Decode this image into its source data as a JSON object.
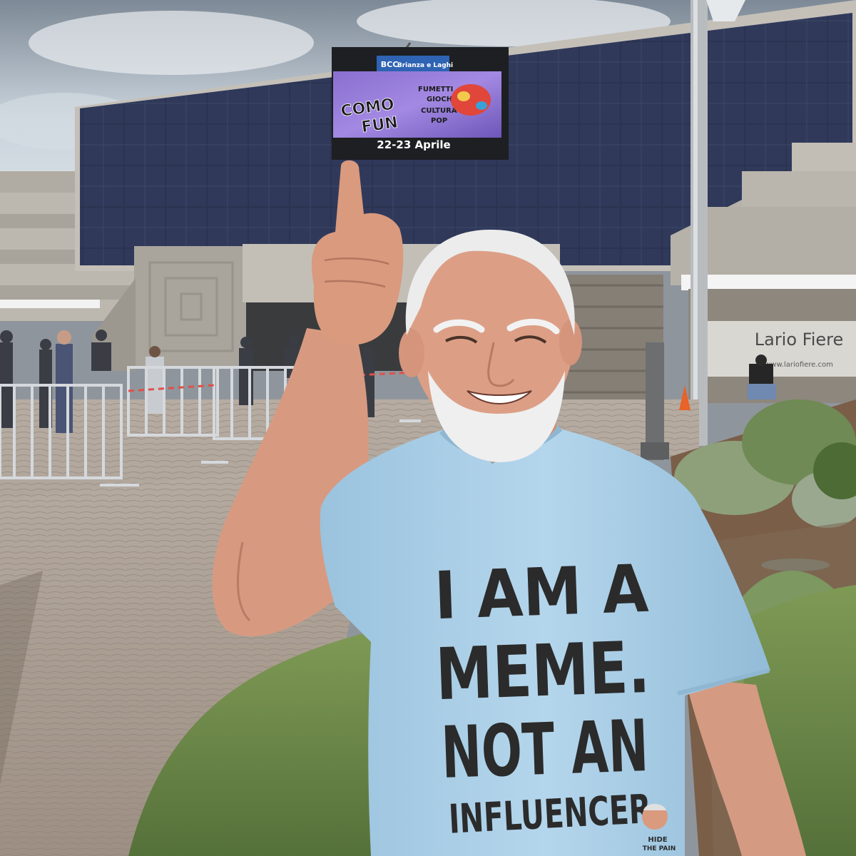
{
  "scene": {
    "billboard": {
      "sponsor_badge": "BCC",
      "sponsor_text": "Brianza e Laghi",
      "line1": "COMO",
      "line2": "FUN",
      "sub1": "FUMETTI",
      "sub2": "GIOCHI",
      "sub3": "CULTURA",
      "sub4": "POP",
      "dates": "22-23 Aprile"
    },
    "venue_sign": {
      "name": "Lario Fiere",
      "url": "www.lariofiere.com"
    },
    "tshirt": {
      "line1": "I AM A",
      "line2": "MEME.",
      "line3": "NOT AN",
      "line4": "INFLUENCER.",
      "logo_line1": "HIDE",
      "logo_line2": "THE PAIN"
    },
    "colors": {
      "sky": "#c9d3dc",
      "solar_panels": "#2a3350",
      "concrete": "#b7b3aa",
      "pavement": "#a89c91",
      "grass": "#6f8b4a",
      "shirt": "#a9cfe8",
      "skin": "#d79a80",
      "hair": "#ececec"
    }
  }
}
